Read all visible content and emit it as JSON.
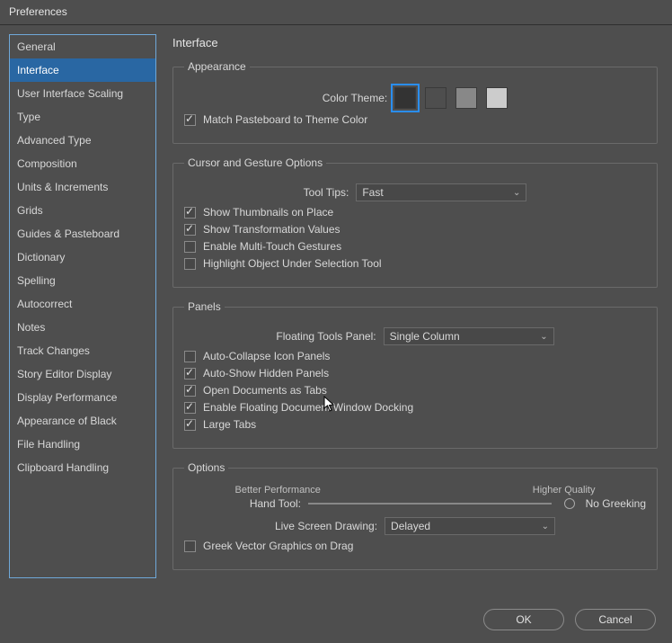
{
  "window": {
    "title": "Preferences"
  },
  "sidebar": {
    "items": [
      "General",
      "Interface",
      "User Interface Scaling",
      "Type",
      "Advanced Type",
      "Composition",
      "Units & Increments",
      "Grids",
      "Guides & Pasteboard",
      "Dictionary",
      "Spelling",
      "Autocorrect",
      "Notes",
      "Track Changes",
      "Story Editor Display",
      "Display Performance",
      "Appearance of Black",
      "File Handling",
      "Clipboard Handling"
    ],
    "selected": 1
  },
  "page": {
    "title": "Interface"
  },
  "appearance": {
    "legend": "Appearance",
    "color_theme_label": "Color Theme:",
    "swatches": [
      "#333333",
      "#4e4e4e",
      "#888888",
      "#cccccc"
    ],
    "selected_swatch": 0,
    "match_pasteboard": {
      "label": "Match Pasteboard to Theme Color",
      "checked": true
    }
  },
  "cursor": {
    "legend": "Cursor and Gesture Options",
    "tool_tips_label": "Tool Tips:",
    "tool_tips_value": "Fast",
    "thumbnails": {
      "label": "Show Thumbnails on Place",
      "checked": true
    },
    "transform": {
      "label": "Show Transformation Values",
      "checked": true
    },
    "multitouch": {
      "label": "Enable Multi-Touch Gestures",
      "checked": false
    },
    "highlight": {
      "label": "Highlight Object Under Selection Tool",
      "checked": false
    }
  },
  "panels": {
    "legend": "Panels",
    "floating_label": "Floating Tools Panel:",
    "floating_value": "Single Column",
    "auto_collapse": {
      "label": "Auto-Collapse Icon Panels",
      "checked": false
    },
    "auto_show": {
      "label": "Auto-Show Hidden Panels",
      "checked": true
    },
    "open_tabs": {
      "label": "Open Documents as Tabs",
      "checked": true
    },
    "floating_dock": {
      "label": "Enable Floating Document Window Docking",
      "checked": true
    },
    "large_tabs": {
      "label": "Large Tabs",
      "checked": true
    }
  },
  "options": {
    "legend": "Options",
    "perf_label": "Better Performance",
    "qual_label": "Higher Quality",
    "hand_tool_label": "Hand Tool:",
    "no_greeking_label": "No Greeking",
    "live_label": "Live Screen Drawing:",
    "live_value": "Delayed",
    "greek_vector": {
      "label": "Greek Vector Graphics on Drag",
      "checked": false
    }
  },
  "buttons": {
    "ok": "OK",
    "cancel": "Cancel"
  }
}
